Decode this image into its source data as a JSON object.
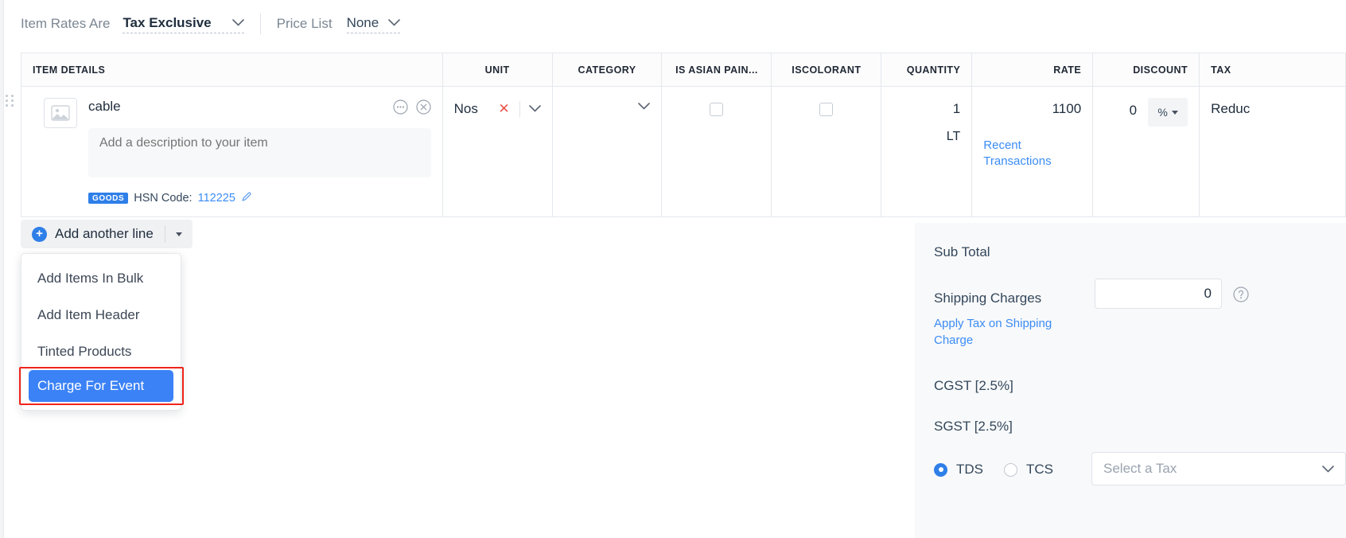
{
  "rates_bar": {
    "item_rates_label": "Item Rates Are",
    "item_rates_value": "Tax Exclusive",
    "price_list_label": "Price List",
    "price_list_value": "None"
  },
  "table": {
    "headers": {
      "item_details": "ITEM DETAILS",
      "unit": "UNIT",
      "category": "CATEGORY",
      "is_asian_paint": "IS ASIAN PAIN...",
      "iscolorant": "ISCOLORANT",
      "quantity": "QUANTITY",
      "rate": "RATE",
      "discount": "DISCOUNT",
      "tax": "TAX"
    },
    "row": {
      "item_name": "cable",
      "description_placeholder": "Add a description to your item",
      "goods_badge": "GOODS",
      "hsn_label": "HSN Code:",
      "hsn_value": "112225",
      "unit": "Nos",
      "quantity": "1",
      "quantity_unit": "LT",
      "rate": "1100",
      "recent_transactions": "Recent Transactions",
      "discount": "0",
      "discount_type": "%",
      "tax": "Reduc"
    }
  },
  "add_line": {
    "label": "Add another line",
    "menu_items": [
      {
        "label": "Add Items In Bulk",
        "selected": false
      },
      {
        "label": "Add Item Header",
        "selected": false
      },
      {
        "label": "Tinted Products",
        "selected": false
      },
      {
        "label": "Charge For Event",
        "selected": true
      }
    ]
  },
  "totals": {
    "sub_total_label": "Sub Total",
    "shipping_charges_label": "Shipping Charges",
    "shipping_charges_value": "0",
    "apply_tax_link": "Apply Tax on Shipping Charge",
    "cgst_label": "CGST [2.5%]",
    "sgst_label": "SGST [2.5%]",
    "tds_label": "TDS",
    "tcs_label": "TCS",
    "tax_select_placeholder": "Select a Tax"
  },
  "colors": {
    "accent_blue": "#2f7fe8",
    "selected_blue": "#3b82f6",
    "link_blue": "#3b8cf5",
    "highlight_red": "#f0241a",
    "remove_red": "#e8554a"
  }
}
